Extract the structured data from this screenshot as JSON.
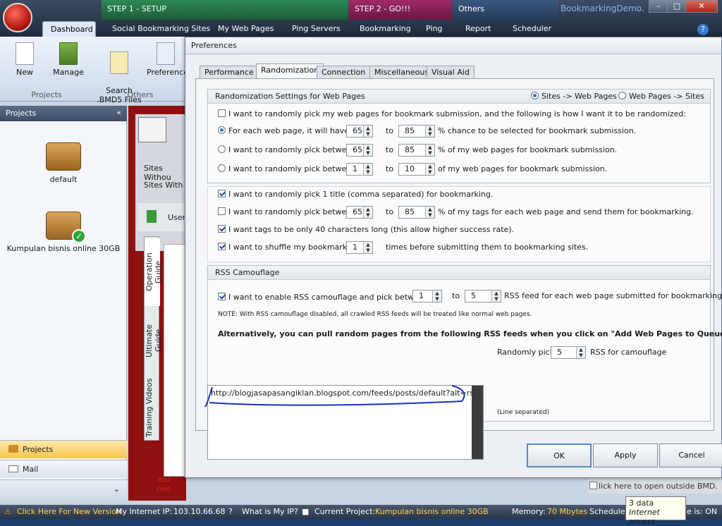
{
  "app": {
    "title": "BookmarkingDemo.",
    "groups": [
      "STEP 1 - SETUP",
      "STEP 2 - GO!!!",
      "Others"
    ],
    "tabs": [
      "Dashboard",
      "Social Bookmarking Sites",
      "My Web Pages",
      "Ping Servers",
      "Bookmarking",
      "Ping",
      "Report",
      "Scheduler"
    ],
    "window_buttons": [
      "–",
      "□",
      "✕"
    ],
    "help": "?"
  },
  "ribbon": {
    "buttons": [
      "New",
      "Manage",
      "Search\n.BMD5 Files",
      "Preferences"
    ],
    "groups": [
      "Projects",
      "Others"
    ]
  },
  "left_panel": {
    "title": "Projects",
    "collapse": "«",
    "projects": [
      "default",
      "Kumpulan bisnis online 30GB"
    ],
    "nav": [
      "Projects",
      "Mail"
    ]
  },
  "background": {
    "sites_without": "Sites Withou",
    "sites_with": "Sites With C",
    "user_tab": "User",
    "vtabs": [
      "Operation Guide",
      "Ultimate Guide",
      "Training Videos"
    ],
    "footer_text": "You nee",
    "checkbox_text": "lick here to open outside BMD."
  },
  "status_bar": {
    "new_version": "Click Here For New Version",
    "ip_label": "My Internet IP:",
    "ip_value": "103.10.66.68",
    "what_ip": "What is My IP?",
    "project_label": "Current Project:",
    "project_value": "Kumpulan bisnis online 30GB",
    "memory_label": "Memory:",
    "memory_value": "70 Mbytes",
    "scheduler": "Scheduler",
    "tail": "e is:  ON"
  },
  "tooltip": {
    "line1": "3 data",
    "line2": "Internet access"
  },
  "dialog": {
    "title": "Preferences",
    "tabs": [
      "Performance",
      "Randomization",
      "Connection",
      "Miscellaneous",
      "Visual Aid"
    ],
    "active_tab": "Randomization",
    "rand_section": {
      "title": "Randomization Settings for Web Pages",
      "mode_options": [
        "Sites -> Web Pages",
        "Web Pages -> Sites"
      ],
      "pick_pages": "I want to randomly pick my web pages for bookmark submission, and the following is how I want it to be randomized:",
      "opt1": {
        "label": "For each web page, it will have",
        "from": "65",
        "to": "85",
        "suffix": "% chance to be selected for bookmark submission."
      },
      "opt2": {
        "label": "I want to randomly pick between",
        "from": "65",
        "to": "85",
        "suffix": "% of my web pages for bookmark submission."
      },
      "opt3": {
        "label": "I want to randomly pick between",
        "from": "1",
        "to": "10",
        "suffix": "of my web pages for bookmark submission."
      },
      "to_word": "to"
    },
    "title_section": {
      "pick_title": "I want to randomly pick 1 title (comma separated) for bookmarking.",
      "tags": {
        "label": "I want to randomly pick between",
        "from": "65",
        "to": "85",
        "suffix": "% of my tags for each web page and send them for bookmarking."
      },
      "tags_len": "I want tags to be only 40 characters long (this allow higher success rate).",
      "shuffle": {
        "label": "I want to shuffle my bookmarks",
        "value": "1",
        "suffix": "times before submitting them to bookmarking sites."
      }
    },
    "rss_section": {
      "title": "RSS Camouflage",
      "enable": {
        "label": "I want to enable RSS camouflage and pick between",
        "from": "1",
        "to": "5",
        "suffix": "RSS feed for each web page submitted for bookmarking."
      },
      "note": "NOTE: With RSS camouflage disabled, all crawled RSS feeds will be treated like normal web pages.",
      "alternative": "Alternatively, you can pull random pages from the following RSS feeds when you click on \"Add Web Pages to Queue\".",
      "feed_url": "http://blogjasapasangiklan.blogspot.com/feeds/posts/default?alt=rss",
      "random_pick": {
        "label": "Randomly pick",
        "value": "5",
        "suffix": "RSS for camouflage"
      },
      "line_separated": "(Line separated)"
    },
    "buttons": [
      "OK",
      "Apply",
      "Cancel"
    ]
  }
}
